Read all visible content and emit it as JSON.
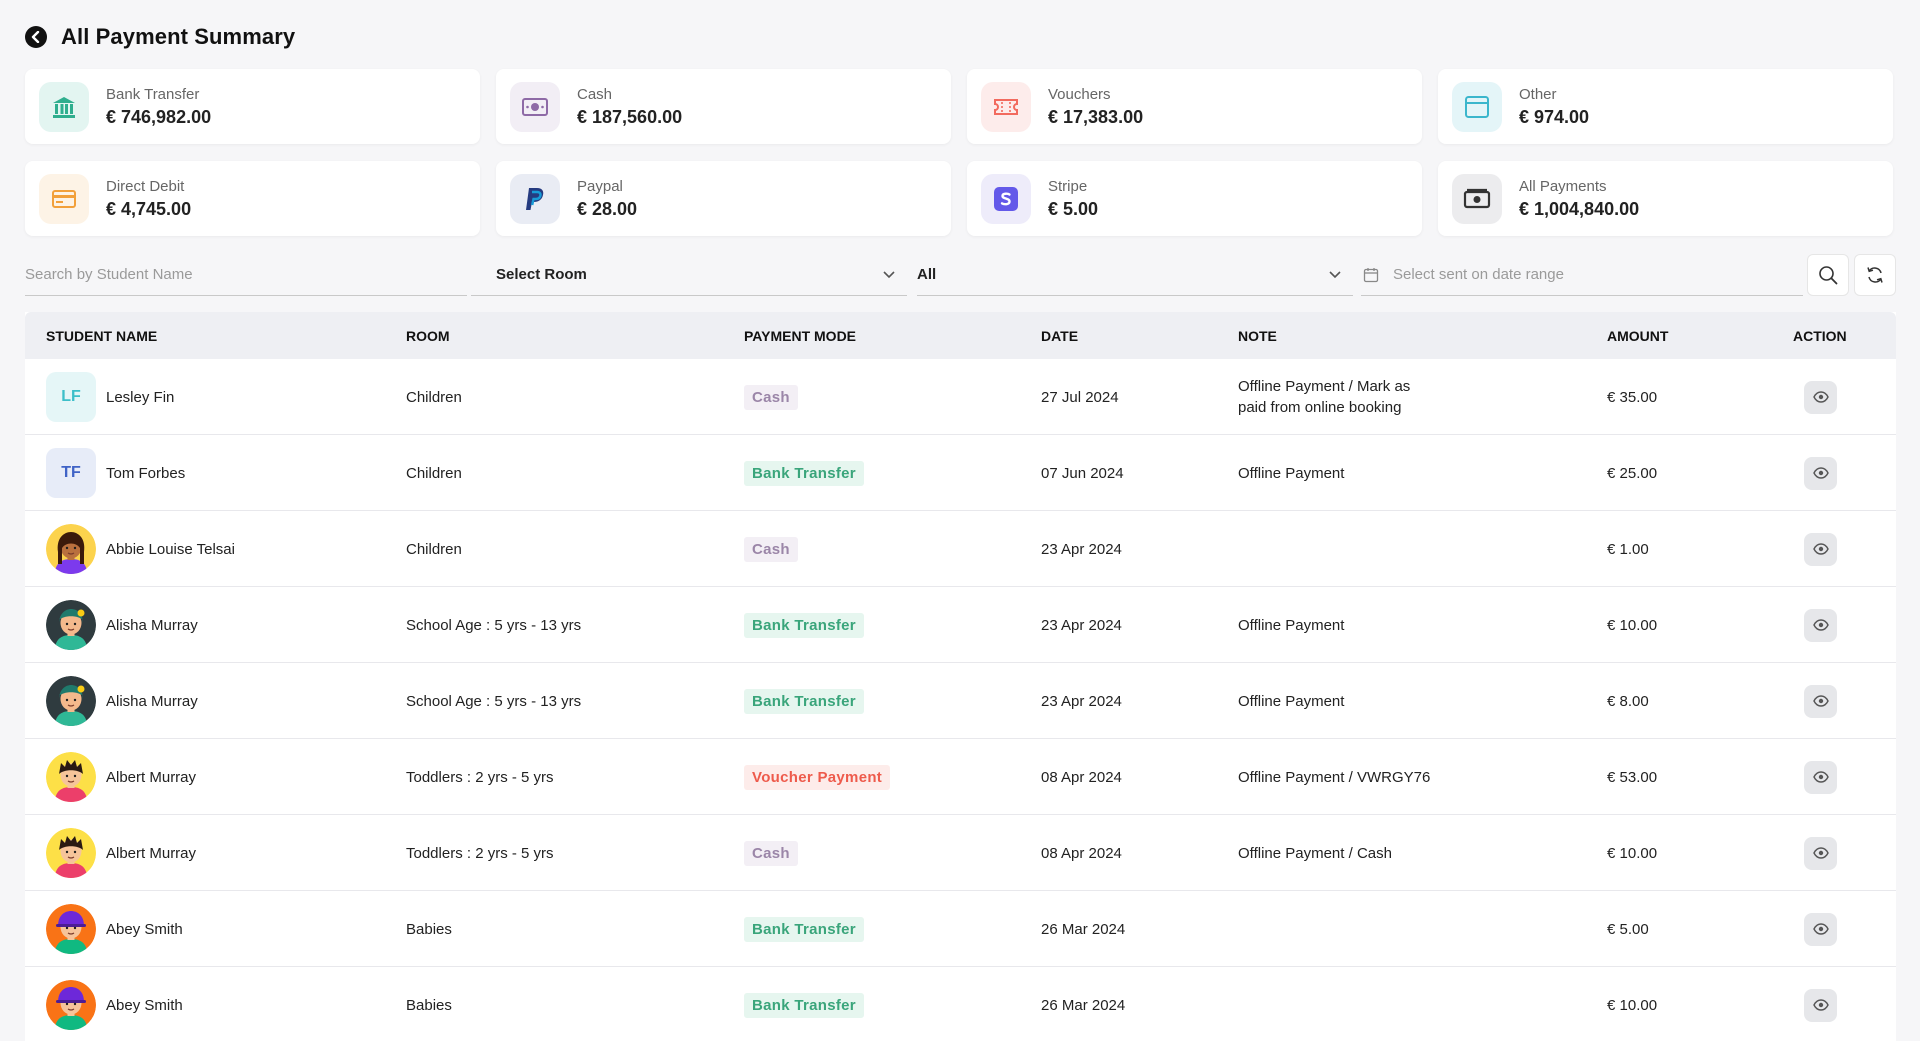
{
  "header": {
    "title": "All Payment Summary"
  },
  "cards": [
    {
      "label": "Bank Transfer",
      "value": "€ 746,982.00",
      "icon": "bank-icon",
      "bg": "#e3f5f1",
      "fg": "#2fae8e"
    },
    {
      "label": "Cash",
      "value": "€ 187,560.00",
      "icon": "cash-icon",
      "bg": "#f2eef5",
      "fg": "#8e6aa6"
    },
    {
      "label": "Vouchers",
      "value": "€ 17,383.00",
      "icon": "voucher-icon",
      "bg": "#fdeceb",
      "fg": "#f26a5e"
    },
    {
      "label": "Other",
      "value": "€ 974.00",
      "icon": "window-icon",
      "bg": "#e4f5f8",
      "fg": "#3bb6cc"
    },
    {
      "label": "Direct Debit",
      "value": "€ 4,745.00",
      "icon": "card-icon",
      "bg": "#fdf3e6",
      "fg": "#f2a03a"
    },
    {
      "label": "Paypal",
      "value": "€ 28.00",
      "icon": "paypal-icon",
      "bg": "#e9ecf4",
      "fg": "#253b80"
    },
    {
      "label": "Stripe",
      "value": "€ 5.00",
      "icon": "stripe-icon",
      "bg": "#eeecfa",
      "fg": "#6359e9"
    },
    {
      "label": "All Payments",
      "value": "€ 1,004,840.00",
      "icon": "money-icon",
      "bg": "#ececee",
      "fg": "#333333"
    }
  ],
  "filters": {
    "search_placeholder": "Search by Student Name",
    "room_value": "Select Room",
    "mode_value": "All",
    "date_placeholder": "Select sent on date range"
  },
  "table": {
    "headers": {
      "student": "STUDENT NAME",
      "room": "ROOM",
      "mode": "PAYMENT MODE",
      "date": "DATE",
      "note": "NOTE",
      "amount": "AMOUNT",
      "action": "ACTION"
    },
    "rows": [
      {
        "name": "Lesley Fin",
        "avatar": "initials",
        "initials": "LF",
        "room": "Children",
        "mode": "Cash",
        "date": "27 Jul 2024",
        "note": "Offline Payment / Mark as\npaid from online booking",
        "amount": "€ 35.00"
      },
      {
        "name": "Tom Forbes",
        "avatar": "initials",
        "initials": "TF",
        "room": "Children",
        "mode": "Bank Transfer",
        "date": "07 Jun 2024",
        "note": "Offline Payment",
        "amount": "€ 25.00"
      },
      {
        "name": "Abbie Louise Telsai",
        "avatar": "girl-yellow",
        "initials": "",
        "room": "Children",
        "mode": "Cash",
        "date": "23 Apr 2024",
        "note": "",
        "amount": "€ 1.00"
      },
      {
        "name": "Alisha Murray",
        "avatar": "girl-dark",
        "initials": "",
        "room": "School Age : 5 yrs - 13 yrs",
        "mode": "Bank Transfer",
        "date": "23 Apr 2024",
        "note": "Offline Payment",
        "amount": "€ 10.00"
      },
      {
        "name": "Alisha Murray",
        "avatar": "girl-dark",
        "initials": "",
        "room": "School Age : 5 yrs - 13 yrs",
        "mode": "Bank Transfer",
        "date": "23 Apr 2024",
        "note": "Offline Payment",
        "amount": "€ 8.00"
      },
      {
        "name": "Albert Murray",
        "avatar": "boy-yellow",
        "initials": "",
        "room": "Toddlers : 2 yrs - 5 yrs",
        "mode": "Voucher Payment",
        "date": "08 Apr 2024",
        "note": "Offline Payment / VWRGY76",
        "amount": "€ 53.00"
      },
      {
        "name": "Albert Murray",
        "avatar": "boy-yellow",
        "initials": "",
        "room": "Toddlers : 2 yrs - 5 yrs",
        "mode": "Cash",
        "date": "08 Apr 2024",
        "note": "Offline Payment / Cash",
        "amount": "€ 10.00"
      },
      {
        "name": "Abey Smith",
        "avatar": "boy-orange",
        "initials": "",
        "room": "Babies",
        "mode": "Bank Transfer",
        "date": "26 Mar 2024",
        "note": "",
        "amount": "€ 5.00"
      },
      {
        "name": "Abey Smith",
        "avatar": "boy-orange",
        "initials": "",
        "room": "Babies",
        "mode": "Bank Transfer",
        "date": "26 Mar 2024",
        "note": "",
        "amount": "€ 10.00"
      }
    ]
  },
  "badge_styles": {
    "Cash": {
      "bg": "#f3eff5",
      "fg": "#9b86a8"
    },
    "Bank Transfer": {
      "bg": "#e6f6ef",
      "fg": "#3aa57b"
    },
    "Voucher Payment": {
      "bg": "#fdecea",
      "fg": "#ee5b4c"
    }
  },
  "initials_styles": {
    "LF": {
      "bg": "#e5f6f7",
      "fg": "#3dbfc9"
    },
    "TF": {
      "bg": "#e7ecf8",
      "fg": "#4063c6"
    }
  }
}
